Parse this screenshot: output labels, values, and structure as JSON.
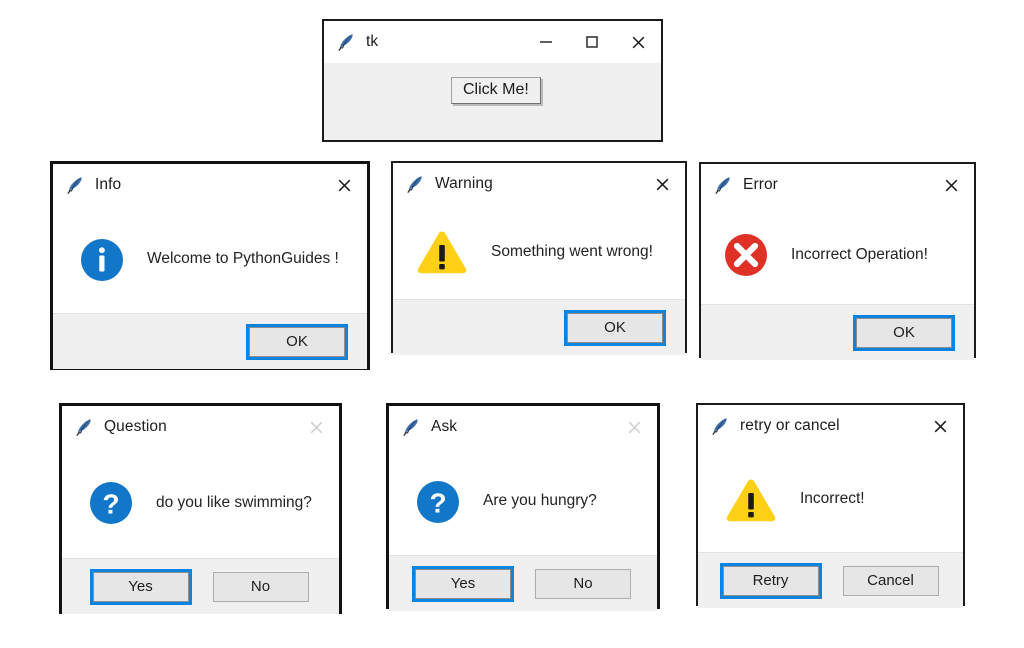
{
  "main_window": {
    "title": "tk",
    "icon": "feather-icon",
    "controls": [
      {
        "name": "minimize",
        "glyph": "minimize-icon"
      },
      {
        "name": "maximize",
        "glyph": "maximize-icon"
      },
      {
        "name": "close",
        "glyph": "close-icon"
      }
    ],
    "button_label": "Click Me!"
  },
  "colors": {
    "info_blue": "#1277c9",
    "warning_yellow": "#ffd016",
    "error_red": "#e03127",
    "focus_blue": "#0a84e0",
    "titlebar_bg": "#ffffff",
    "footer_bg": "#f0f0f0",
    "body_bg": "#ffffff",
    "border_black": "#121212"
  },
  "dialogs": [
    {
      "id": "info",
      "title": "Info",
      "icon": "feather-icon",
      "close_enabled": true,
      "message": "Welcome to PythonGuides !",
      "message_icon": "info-icon",
      "buttons": [
        {
          "label": "OK",
          "focused": true
        }
      ],
      "button_align": "right"
    },
    {
      "id": "warning",
      "title": "Warning",
      "icon": "feather-icon",
      "close_enabled": true,
      "message": "Something went wrong!",
      "message_icon": "warning-icon",
      "buttons": [
        {
          "label": "OK",
          "focused": true
        }
      ],
      "button_align": "right"
    },
    {
      "id": "error",
      "title": "Error",
      "icon": "feather-icon",
      "close_enabled": true,
      "message": "Incorrect Operation!",
      "message_icon": "error-icon",
      "buttons": [
        {
          "label": "OK",
          "focused": true
        }
      ],
      "button_align": "right"
    },
    {
      "id": "question",
      "title": "Question",
      "icon": "feather-icon",
      "close_enabled": false,
      "message": "do you like swimming?",
      "message_icon": "question-icon",
      "buttons": [
        {
          "label": "Yes",
          "focused": true
        },
        {
          "label": "No",
          "focused": false
        }
      ],
      "button_align": "center"
    },
    {
      "id": "ask",
      "title": "Ask",
      "icon": "feather-icon",
      "close_enabled": false,
      "message": "Are you hungry?",
      "message_icon": "question-icon",
      "buttons": [
        {
          "label": "Yes",
          "focused": true
        },
        {
          "label": "No",
          "focused": false
        }
      ],
      "button_align": "center"
    },
    {
      "id": "retry",
      "title": "retry or cancel",
      "icon": "feather-icon",
      "close_enabled": true,
      "message": "Incorrect!",
      "message_icon": "warning-icon",
      "buttons": [
        {
          "label": "Retry",
          "focused": true
        },
        {
          "label": "Cancel",
          "focused": false
        }
      ],
      "button_align": "center"
    }
  ]
}
